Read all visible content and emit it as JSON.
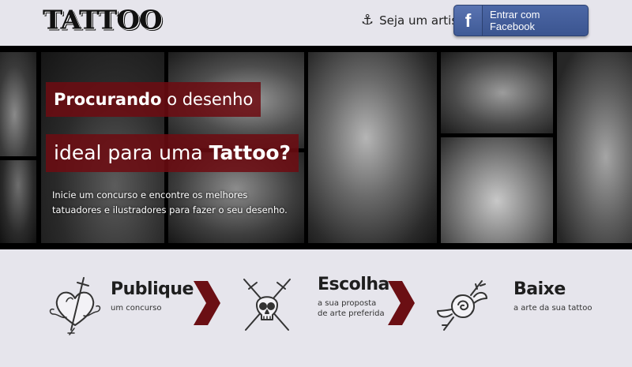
{
  "header": {
    "logo_text": "TATTOO",
    "artist_link_label": "Seja um artista",
    "facebook_button": {
      "icon_letter": "f",
      "label": "Entrar com Facebook"
    }
  },
  "hero": {
    "headline_line1_bold": "Procurando",
    "headline_line1_rest": " o desenho",
    "headline_line2_rest": "ideal para uma ",
    "headline_line2_bold": "Tattoo?",
    "description": "Inicie um concurso e encontre os melhores tatuadores e ilustradores para fazer o seu desenho."
  },
  "steps": [
    {
      "title": "Publique",
      "subtitle_line1": "um concurso",
      "subtitle_line2": "",
      "icon": "heart-dagger-icon"
    },
    {
      "title": "Escolha",
      "subtitle_line1": "a sua proposta",
      "subtitle_line2": "de arte preferida",
      "icon": "skull-daggers-icon"
    },
    {
      "title": "Baixe",
      "subtitle_line1": "a arte da sua tattoo",
      "subtitle_line2": "",
      "icon": "rose-icon"
    }
  ],
  "colors": {
    "background": "#e6e5ec",
    "accent_red": "#6e0c12",
    "facebook_blue": "#3b5590",
    "chevron_red": "#6b0f14"
  }
}
